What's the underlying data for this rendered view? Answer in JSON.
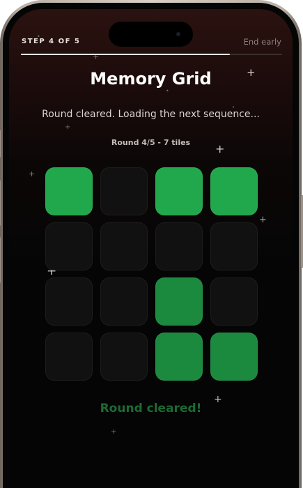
{
  "header": {
    "step_label": "STEP 4 OF 5",
    "end_early_label": "End early",
    "progress": 0.8
  },
  "game": {
    "title": "Memory Grid",
    "status_message": "Round cleared. Loading the next sequence...",
    "round_info": "Round 4/5 - 7 tiles",
    "result_message": "Round cleared!",
    "grid": {
      "rows": 4,
      "cols": 4,
      "lit": [
        [
          1,
          0,
          1,
          1
        ],
        [
          0,
          0,
          0,
          0
        ],
        [
          0,
          0,
          1,
          0
        ],
        [
          0,
          0,
          1,
          1
        ]
      ]
    }
  },
  "colors": {
    "tile_lit": "#22a84c",
    "tile_dim": "#111111",
    "result_text": "#1d6a34"
  }
}
